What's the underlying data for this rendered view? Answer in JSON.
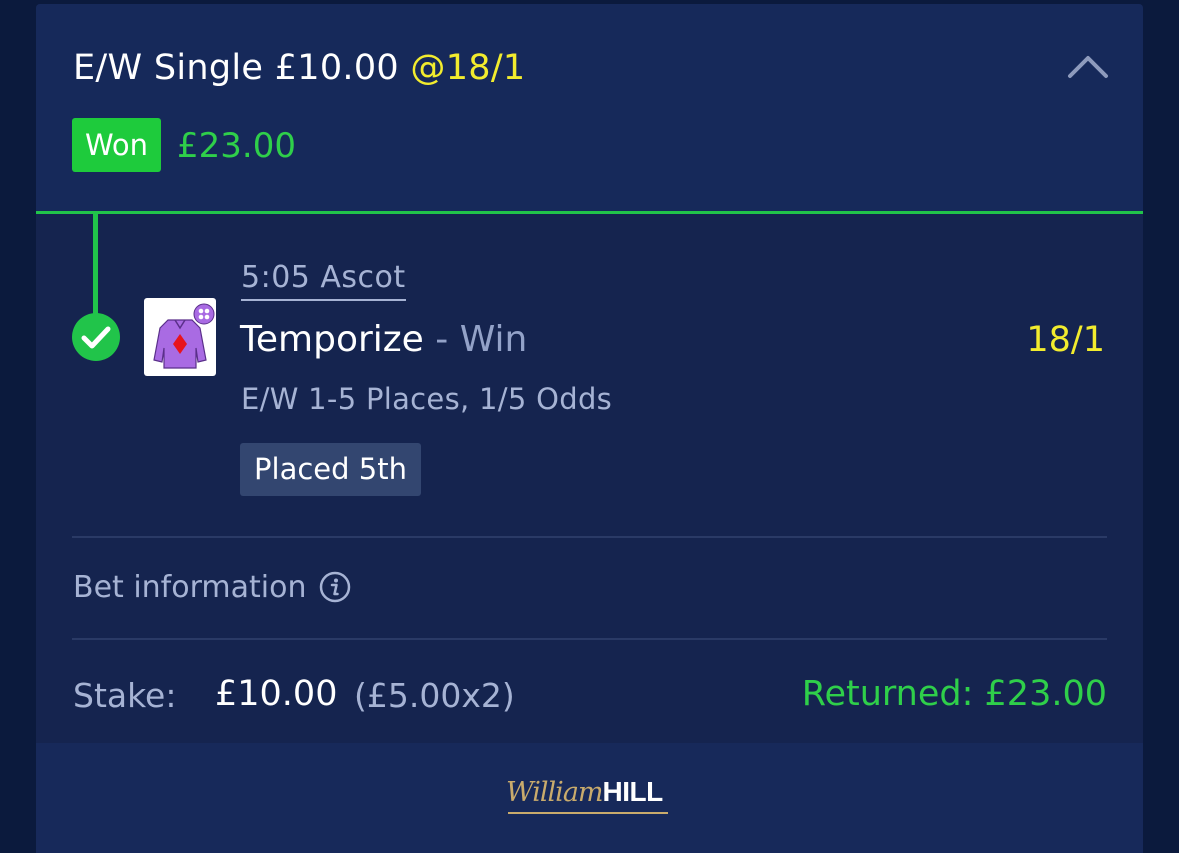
{
  "bet": {
    "type_label": "E/W Single",
    "stake": "£10.00",
    "odds": "@18/1",
    "status": "Won",
    "won_amount": "£23.00"
  },
  "selection": {
    "race": "5:05 Ascot",
    "horse": "Temporize",
    "separator": " - ",
    "market": "Win",
    "odds": "18/1",
    "terms": "E/W 1-5 Places, 1/5 Odds",
    "result": "Placed 5th",
    "silk_colors": {
      "body": "#a96be3",
      "diamond": "#e8141c",
      "cap": "#a96be3"
    }
  },
  "bet_info": {
    "label": "Bet information"
  },
  "summary": {
    "stake_label": "Stake:",
    "stake_value": "£10.00",
    "stake_split": "(£5.00x2)",
    "returned": "Returned: £23.00"
  },
  "footer": {
    "logo_script": "William",
    "logo_bold": "HILL"
  },
  "colors": {
    "accent_green": "#21c44a",
    "odds_yellow": "#f2ec2e",
    "card_bg": "#15244f",
    "page_bg": "#0b1a3d"
  },
  "icons": {
    "collapse": "chevron-up-icon",
    "status": "check-circle-icon",
    "info": "info-icon"
  }
}
